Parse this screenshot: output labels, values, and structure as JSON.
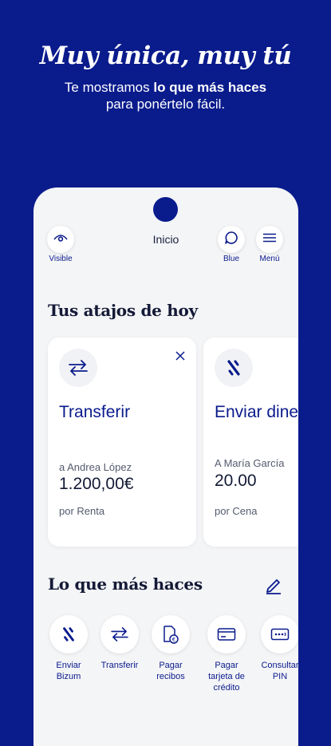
{
  "hero": {
    "title": "Muy única, muy tú",
    "subtitle_pre": "Te mostramos ",
    "subtitle_bold": "lo que más haces",
    "subtitle_line2": "para ponértelo fácil."
  },
  "topbar": {
    "visible_label": "Visible",
    "title": "Inicio",
    "blue_label": "Blue",
    "menu_label": "Menú"
  },
  "shortcuts": {
    "title": "Tus atajos de hoy",
    "cards": [
      {
        "title": "Transferir",
        "to": "a Andrea López",
        "amount": "1.200,00€",
        "concept": "por Renta"
      },
      {
        "title": "Enviar dinero",
        "to": "A María García",
        "amount": "20.00",
        "concept": "por Cena"
      }
    ]
  },
  "frequent": {
    "title": "Lo que más haces",
    "items": [
      {
        "label_1": "Enviar",
        "label_2": "Bizum",
        "label_3": ""
      },
      {
        "label_1": "Transferir",
        "label_2": "",
        "label_3": ""
      },
      {
        "label_1": "Pagar",
        "label_2": "recibos",
        "label_3": ""
      },
      {
        "label_1": "Pagar",
        "label_2": "tarjeta de",
        "label_3": "crédito"
      },
      {
        "label_1": "Consultar",
        "label_2": "PIN",
        "label_3": ""
      }
    ]
  },
  "colors": {
    "brand": "#0a1b8c",
    "background": "#f4f5f7"
  }
}
